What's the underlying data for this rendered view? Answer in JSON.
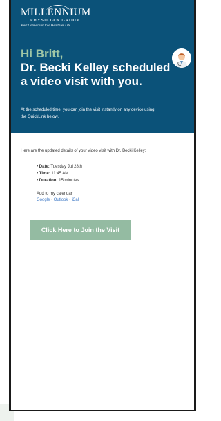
{
  "logo": {
    "name": "MILLENNIUM",
    "subtitle": "PHYSICIAN GROUP",
    "tagline": "Your Connection to a Healthier Life"
  },
  "header": {
    "greeting": "Hi Britt,",
    "headline": "Dr. Becki Kelley scheduled a video visit with you.",
    "intro": "At the scheduled time, you can join the visit instantly on any device using the QuickLink below."
  },
  "body": {
    "updated_text": "Here are the updated details of your video visit with Dr. Becki Kelley:",
    "details": [
      {
        "label": "Date:",
        "value": "Tuesday Jul 28th"
      },
      {
        "label": "Time:",
        "value": "11:45 AM"
      },
      {
        "label": "Duration:",
        "value": "15 minutes"
      }
    ],
    "calendar_label": "Add to my calendar:",
    "calendar_links": [
      "Google",
      "Outlook",
      "iCal"
    ],
    "calendar_separator": " · "
  },
  "join_button": "Click Here to Join the Visit",
  "colors": {
    "header_bg": "#0b5279",
    "greeting": "#9fc6a6",
    "button_bg": "#94bba2",
    "link": "#3b76c4"
  }
}
